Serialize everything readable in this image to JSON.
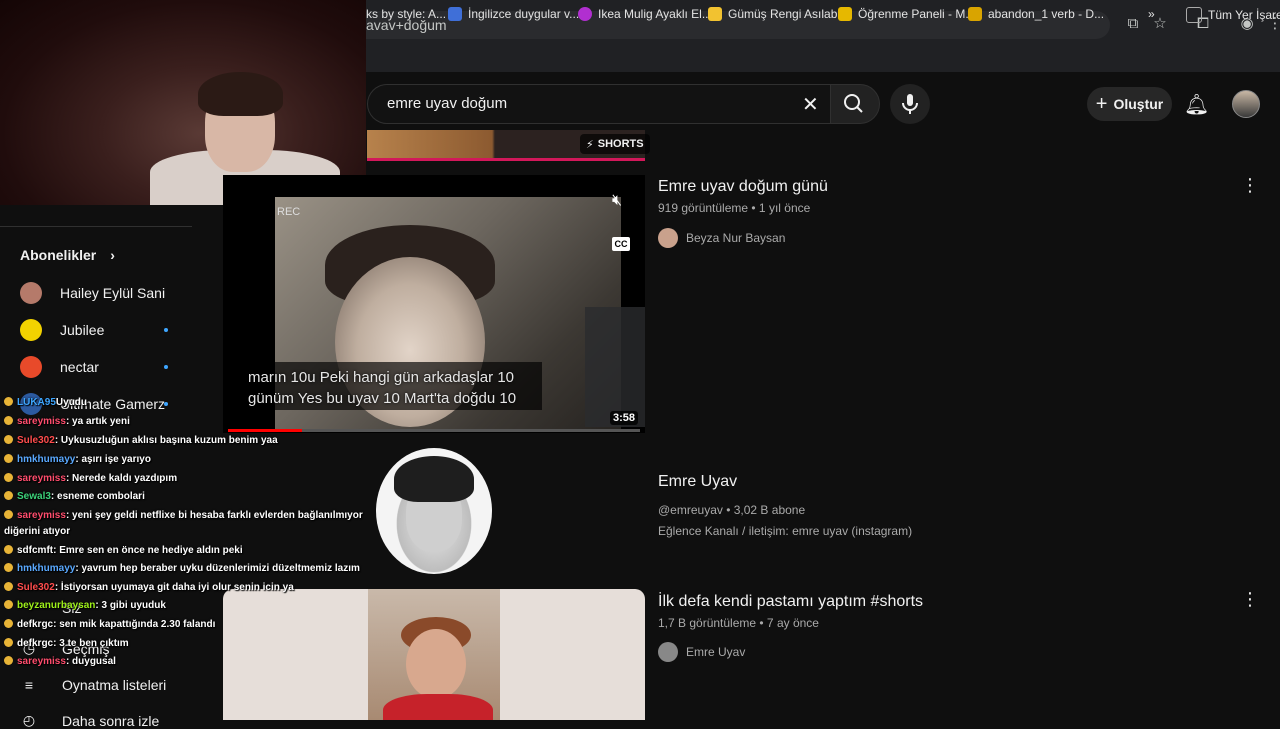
{
  "browser": {
    "url": "avav+doğum",
    "bookmarks": [
      {
        "label": "ks by style: A...",
        "color": "#444"
      },
      {
        "label": "İngilizce duygular v...",
        "color": "#3f6fd8"
      },
      {
        "label": "Ikea Mulig Ayaklı El...",
        "color": "#b12fd0"
      },
      {
        "label": "Gümüş Rengi Asılab...",
        "color": "#f2c230"
      },
      {
        "label": "Öğrenme Paneli - M...",
        "color": "#e6b800"
      },
      {
        "label": "abandon_1 verb - D...",
        "color": "#d9a400"
      },
      {
        "label": "Tüm Yer İşaretle",
        "color": "#777"
      }
    ],
    "more": "»"
  },
  "header": {
    "search_query": "emre uyav doğum",
    "create_label": "Oluştur"
  },
  "sidebar": {
    "subscriptions_title": "Abonelikler",
    "subscriptions": [
      {
        "name": "Hailey Eylül Sani",
        "avatar_color": "#b57a6a",
        "new": false
      },
      {
        "name": "Jubilee",
        "avatar_color": "#f2d200",
        "new": true
      },
      {
        "name": "nectar",
        "avatar_color": "#e84a2a",
        "new": true
      },
      {
        "name": "Ultimate Gamerz",
        "avatar_color": "#2c5aa0",
        "new": true
      }
    ],
    "bottom": [
      {
        "label": "Siz"
      },
      {
        "label": "Geçmiş"
      },
      {
        "label": "Oynatma listeleri"
      },
      {
        "label": "Daha sonra izle"
      }
    ]
  },
  "chat": [
    {
      "user": "LUKA95",
      "text": "Uyudu",
      "color": "#3ea6ff"
    },
    {
      "user": "sareymiss",
      "text": ": ya artık yeni",
      "color": "#ff4d6d"
    },
    {
      "user": "Sule302",
      "text": ": Uykusuzluğun aklısı başına kuzum benim yaa",
      "color": "#ff4d4d"
    },
    {
      "user": "hmkhumayy",
      "text": ": aşırı işe yarıyo",
      "color": "#5aa9ff"
    },
    {
      "user": "sareymiss",
      "text": ": Nerede kaldı yazdıpım",
      "color": "#ff4d6d"
    },
    {
      "user": "Sewal3",
      "text": ": esneme combolari",
      "color": "#3cd27a"
    },
    {
      "user": "sareymiss",
      "text": ": yeni şey geldi netflixe bi hesaba farklı evlerden bağlanılmıyor",
      "color": "#ff4d6d"
    },
    {
      "user": "",
      "text": "diğerini atıyor",
      "color": "#ffffff"
    },
    {
      "user": "sdfcmft",
      "text": ": Emre sen en önce ne hediye aldın peki",
      "color": "#ffffff"
    },
    {
      "user": "hmkhumayy",
      "text": ": yavrum hep beraber uyku düzenlerimizi düzeltmemiz lazım",
      "color": "#5aa9ff"
    },
    {
      "user": "Sule302",
      "text": ": İstiyorsan uyumaya git daha iyi olur senin icin ya",
      "color": "#ff4d4d"
    },
    {
      "user": "beyzanurbaysan",
      "text": ": 3 gibi uyuduk",
      "color": "#9ef01a"
    },
    {
      "user": "defkrgc",
      "text": ": sen mik kapattığında 2.30 falandı",
      "color": "#ffffff"
    },
    {
      "user": "defkrgc",
      "text": ": 3 te ben çıktım",
      "color": "#ffffff"
    },
    {
      "user": "sareymiss",
      "text": ": duygusal",
      "color": "#ff4d6d"
    }
  ],
  "results": {
    "shorts_badge": "SHORTS",
    "video1": {
      "title": "Emre uyav doğum günü",
      "meta": "919 görüntüleme • 1 yıl önce",
      "channel": "Beyza Nur Baysan",
      "duration": "3:58",
      "subtitle_line1": "marın 10u Peki hangi gün arkadaşlar 10",
      "subtitle_line2": "günüm Yes bu uyav 10 Mart'ta doğdu 10",
      "rec": "REC",
      "cc": "CC",
      "progress": 0.18
    },
    "channel": {
      "name": "Emre Uyav",
      "meta": "@emreuyav • 3,02 B abone",
      "desc": "Eğlence Kanalı / iletişim: emre uyav (instagram)"
    },
    "video2": {
      "title": "İlk defa kendi pastamı yaptım #shorts",
      "meta": "1,7 B görüntüleme • 7 ay önce",
      "channel": "Emre Uyav"
    }
  }
}
